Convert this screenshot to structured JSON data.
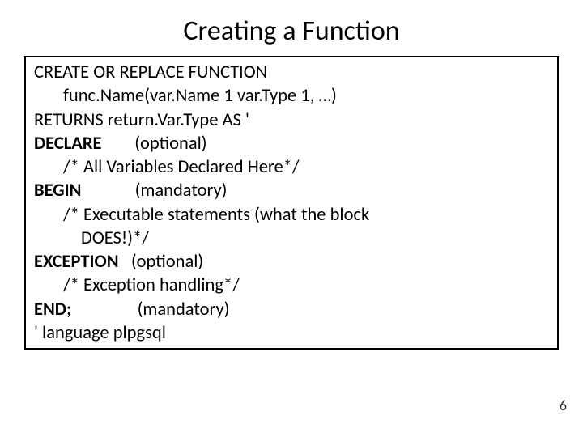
{
  "title": "Creating a Function",
  "lines": {
    "l1": "CREATE OR REPLACE FUNCTION",
    "l2": "func.Name(var.Name 1 var.Type 1, …)",
    "l3": "RETURNS return.Var.Type AS '",
    "l4a": "DECLARE",
    "l4b": "(optional)",
    "l5": "/* All Variables Declared Here*/",
    "l6a": "BEGIN",
    "l6b": "(mandatory)",
    "l7": "/* Executable statements (what the block",
    "l8": "DOES!)*/",
    "l9a": "EXCEPTION",
    "l9b": "(optional)",
    "l10": "/* Exception handling*/",
    "l11a": "END;",
    "l11b": "(mandatory)",
    "l12": "' language plpgsql"
  },
  "page_number": "6"
}
